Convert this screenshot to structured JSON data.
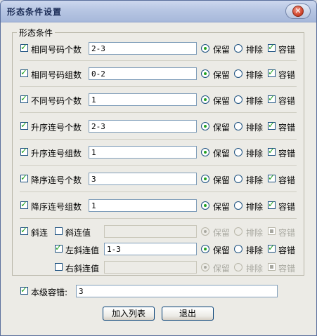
{
  "window": {
    "title": "形态条件设置",
    "close_icon": "close-icon"
  },
  "group": {
    "title": "形态条件"
  },
  "rows": [
    {
      "label": "相同号码个数",
      "checked": true,
      "value": "2-3",
      "keep": "保留",
      "exclude": "排除",
      "tolerance": "容错"
    },
    {
      "label": "相同号码组数",
      "checked": true,
      "value": "0-2",
      "keep": "保留",
      "exclude": "排除",
      "tolerance": "容错"
    },
    {
      "label": "不同号码个数",
      "checked": true,
      "value": "1",
      "keep": "保留",
      "exclude": "排除",
      "tolerance": "容错"
    },
    {
      "label": "升序连号个数",
      "checked": true,
      "value": "2-3",
      "keep": "保留",
      "exclude": "排除",
      "tolerance": "容错"
    },
    {
      "label": "升序连号组数",
      "checked": true,
      "value": "1",
      "keep": "保留",
      "exclude": "排除",
      "tolerance": "容错"
    },
    {
      "label": "降序连号个数",
      "checked": true,
      "value": "3",
      "keep": "保留",
      "exclude": "排除",
      "tolerance": "容错"
    },
    {
      "label": "降序连号组数",
      "checked": true,
      "value": "1",
      "keep": "保留",
      "exclude": "排除",
      "tolerance": "容错"
    }
  ],
  "diagonal": {
    "label": "斜连",
    "checked": true,
    "subs": [
      {
        "label": "斜连值",
        "checked": false,
        "value": "",
        "keep": "保留",
        "exclude": "排除",
        "tolerance": "容错",
        "enabled": false
      },
      {
        "label": "左斜连值",
        "checked": true,
        "value": "1-3",
        "keep": "保留",
        "exclude": "排除",
        "tolerance": "容错",
        "enabled": true
      },
      {
        "label": "右斜连值",
        "checked": false,
        "value": "",
        "keep": "保留",
        "exclude": "排除",
        "tolerance": "容错",
        "enabled": false
      }
    ]
  },
  "level_tolerance": {
    "label": "本级容错:",
    "checked": true,
    "value": "3"
  },
  "buttons": {
    "add": "加入列表",
    "exit": "退出"
  }
}
